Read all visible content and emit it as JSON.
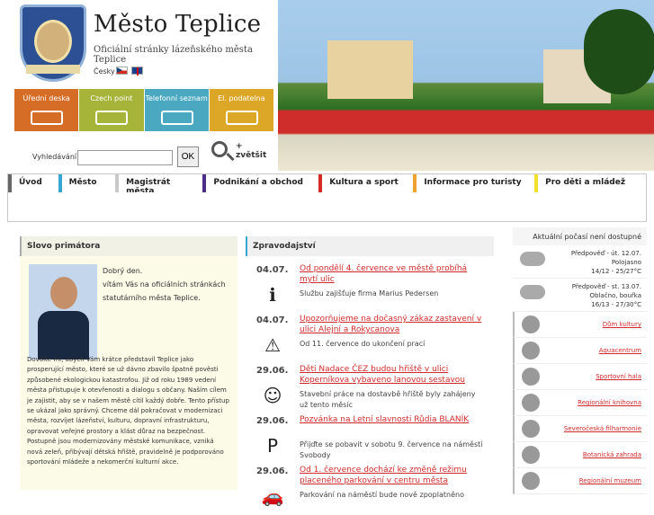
{
  "header": {
    "title": "Město Teplice",
    "subtitle": "Oficiální stránky lázeňského města Teplice",
    "language": "Česky"
  },
  "quick_links": [
    "Úřední deska",
    "Czech point",
    "Telefonní seznam",
    "El. podatelna"
  ],
  "search": {
    "label": "Vyhledávání:",
    "button": "OK",
    "zoom": "+ zvětšit"
  },
  "nav": [
    "Úvod",
    "Město",
    "Magistrát města",
    "Podnikání a obchod",
    "Kultura a sport",
    "Informace pro turisty",
    "Pro děti a mládež"
  ],
  "left": {
    "title": "Slovo primátora",
    "greeting": "Dobrý den.",
    "intro": "vítám Vás na oficiálních stránkách statutárního města Teplice.",
    "text": "Dovolte mi, abych Vám krátce představil Teplice jako prosperující město, které se už dávno zbavilo špatně pověsti způsobené ekologickou katastrofou. Již od roku 1989 vedení města přistupuje k otevřenosti a dialogu s občany. Naším cílem je zajistit, aby se v našem městě cítil každý dobře. Tento přístup se ukázal jako správný. Chceme dál pokračovat v modernizaci města, rozvíjet lázeňství, kulturu, dopravní infrastrukturu, opravovat veřejné prostory a klást důraz na bezpečnost. Postupně jsou modernizovány městské komunikace, vzniká nová zeleň, přibývají dětská hřiště, pravidelně je podporováno sportování mládeže a nekomerční kulturní akce."
  },
  "middle": {
    "title": "Zpravodajství",
    "items": [
      {
        "date": "04.07.",
        "link": "Od pondělí 4. července ve městě probíhá mytí ulic",
        "desc": "Službu zajišťuje firma Marius Pedersen"
      },
      {
        "date": "04.07.",
        "link": "Upozorňujeme na dočasný zákaz zastavení v ulici Alejní a Rokycanova",
        "desc": "Od 11. července do ukončení prací"
      },
      {
        "date": "29.06.",
        "link": "Děti Nadace ČEZ budou hřiště v ulici Koperníkova vybaveno lanovou sestavou",
        "desc": "Stavební práce na dostavbě hřiště byly zahájeny už tento měsíc"
      },
      {
        "date": "29.06.",
        "link": "Pozvánka na Letní slavnosti Růdia BLANÍK",
        "desc": "Přijďte se pobavit v sobotu 9. července na náměstí Svobody"
      },
      {
        "date": "29.06.",
        "link": "Od 1. července dochází ke změně režimu placeného parkování v centru města",
        "desc": "Parkování na náměstí bude nově zpoplatněno"
      }
    ]
  },
  "right": {
    "weather_title": "Aktuální počasí není dostupné",
    "forecast": [
      {
        "day": "Předpověď - út. 12.07.",
        "sky": "Polojasno",
        "temp": "14/12 - 25/27°C"
      },
      {
        "day": "Předpověď - st. 13.07.",
        "sky": "Oblačno, bouřka",
        "temp": "16/13 - 27/30°C"
      }
    ],
    "services": [
      "Dům kultury",
      "Aquacentrum",
      "Sportovní hala",
      "Regionální knihovna",
      "Severočeská filharmonie",
      "Botanická zahrada",
      "Regionální muzeum"
    ]
  }
}
